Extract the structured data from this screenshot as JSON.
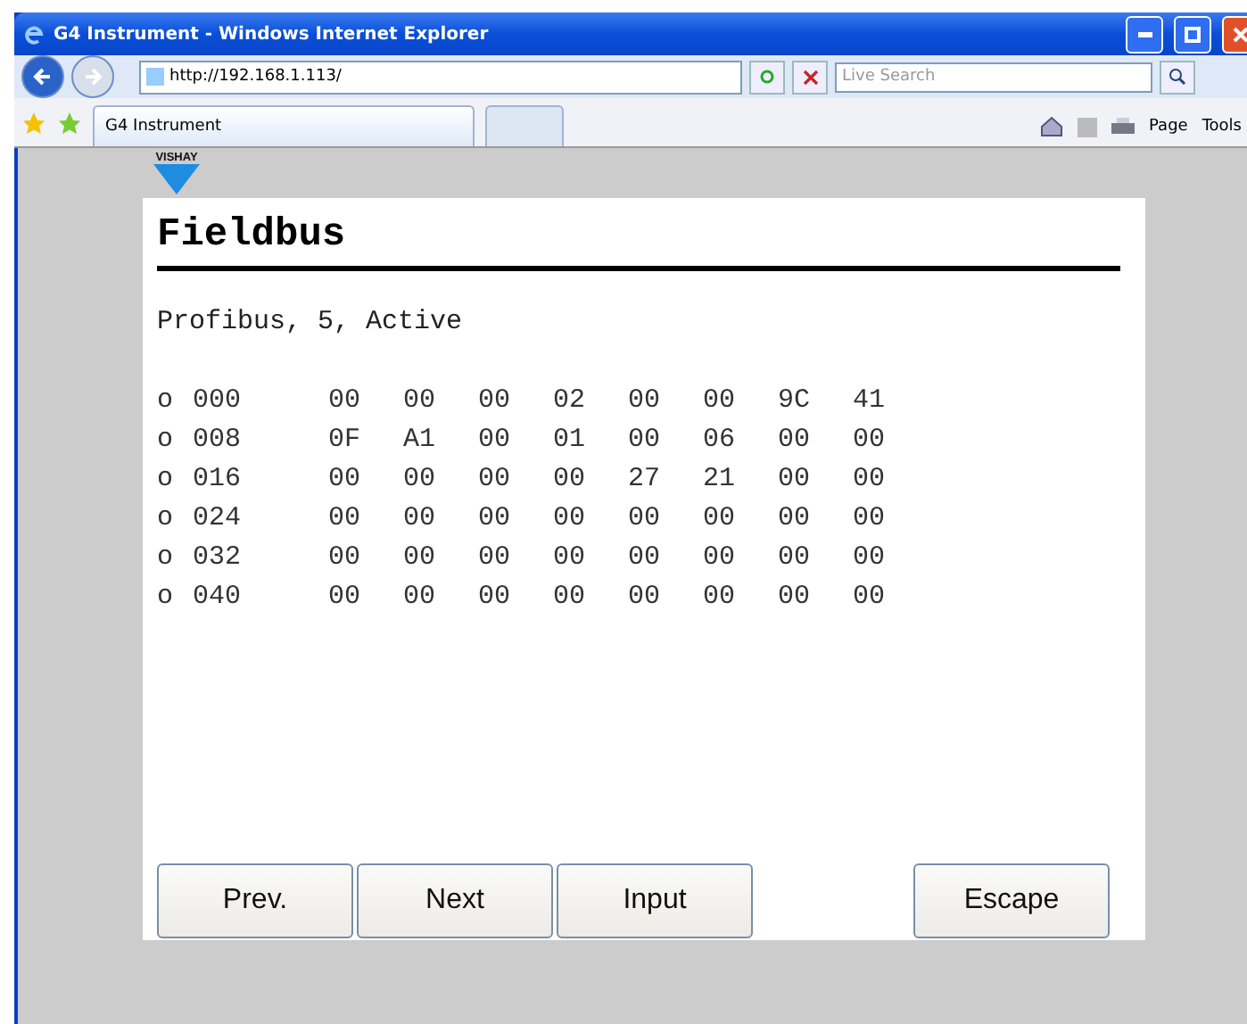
{
  "window": {
    "title": "G4 Instrument - Windows Internet Explorer"
  },
  "address_bar": {
    "url": "http://192.168.1.113/"
  },
  "search": {
    "placeholder": "Live Search"
  },
  "tabs": [
    {
      "label": "G4 Instrument",
      "selected": true
    }
  ],
  "command_bar": [
    "Page",
    "Tools"
  ],
  "logo": {
    "text": "VISHAY"
  },
  "page": {
    "heading": "Fieldbus",
    "status": "Profibus, 5, Active",
    "rows": [
      {
        "marker": "o",
        "address": "000",
        "bytes": [
          "00",
          "00",
          "00",
          "02",
          "00",
          "00",
          "9C",
          "41"
        ]
      },
      {
        "marker": "o",
        "address": "008",
        "bytes": [
          "0F",
          "A1",
          "00",
          "01",
          "00",
          "06",
          "00",
          "00"
        ]
      },
      {
        "marker": "o",
        "address": "016",
        "bytes": [
          "00",
          "00",
          "00",
          "00",
          "27",
          "21",
          "00",
          "00"
        ]
      },
      {
        "marker": "o",
        "address": "024",
        "bytes": [
          "00",
          "00",
          "00",
          "00",
          "00",
          "00",
          "00",
          "00"
        ]
      },
      {
        "marker": "o",
        "address": "032",
        "bytes": [
          "00",
          "00",
          "00",
          "00",
          "00",
          "00",
          "00",
          "00"
        ]
      },
      {
        "marker": "o",
        "address": "040",
        "bytes": [
          "00",
          "00",
          "00",
          "00",
          "00",
          "00",
          "00",
          "00"
        ]
      }
    ],
    "buttons": [
      {
        "label": "Prev.",
        "kind": "left"
      },
      {
        "label": "Next",
        "kind": "left"
      },
      {
        "label": "Input",
        "kind": "left"
      },
      {
        "label": "Escape",
        "kind": "right"
      }
    ]
  }
}
